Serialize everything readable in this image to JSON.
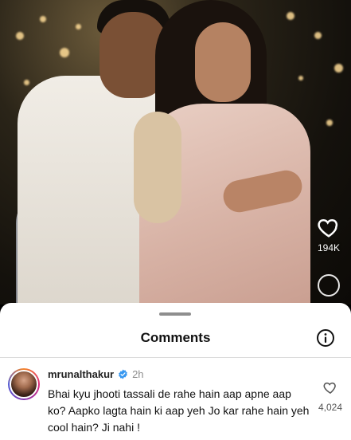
{
  "reel": {
    "like_count": "194K"
  },
  "comments_sheet": {
    "title": "Comments",
    "info_icon": "info-icon"
  },
  "comment": {
    "username": "mrunalthakur",
    "verified": true,
    "time": "2h",
    "text": "Bhai kyu jhooti tassali de rahe hain aap apne aap ko? Aapko lagta hain ki aap yeh Jo kar rahe hain yeh cool hain? Ji nahi !",
    "like_count": "4,024",
    "like_icon": "heart-outline-icon"
  },
  "colors": {
    "verified_badge": "#3797f0",
    "sheet_background": "#ffffff",
    "secondary_text": "#8e8e8e"
  }
}
